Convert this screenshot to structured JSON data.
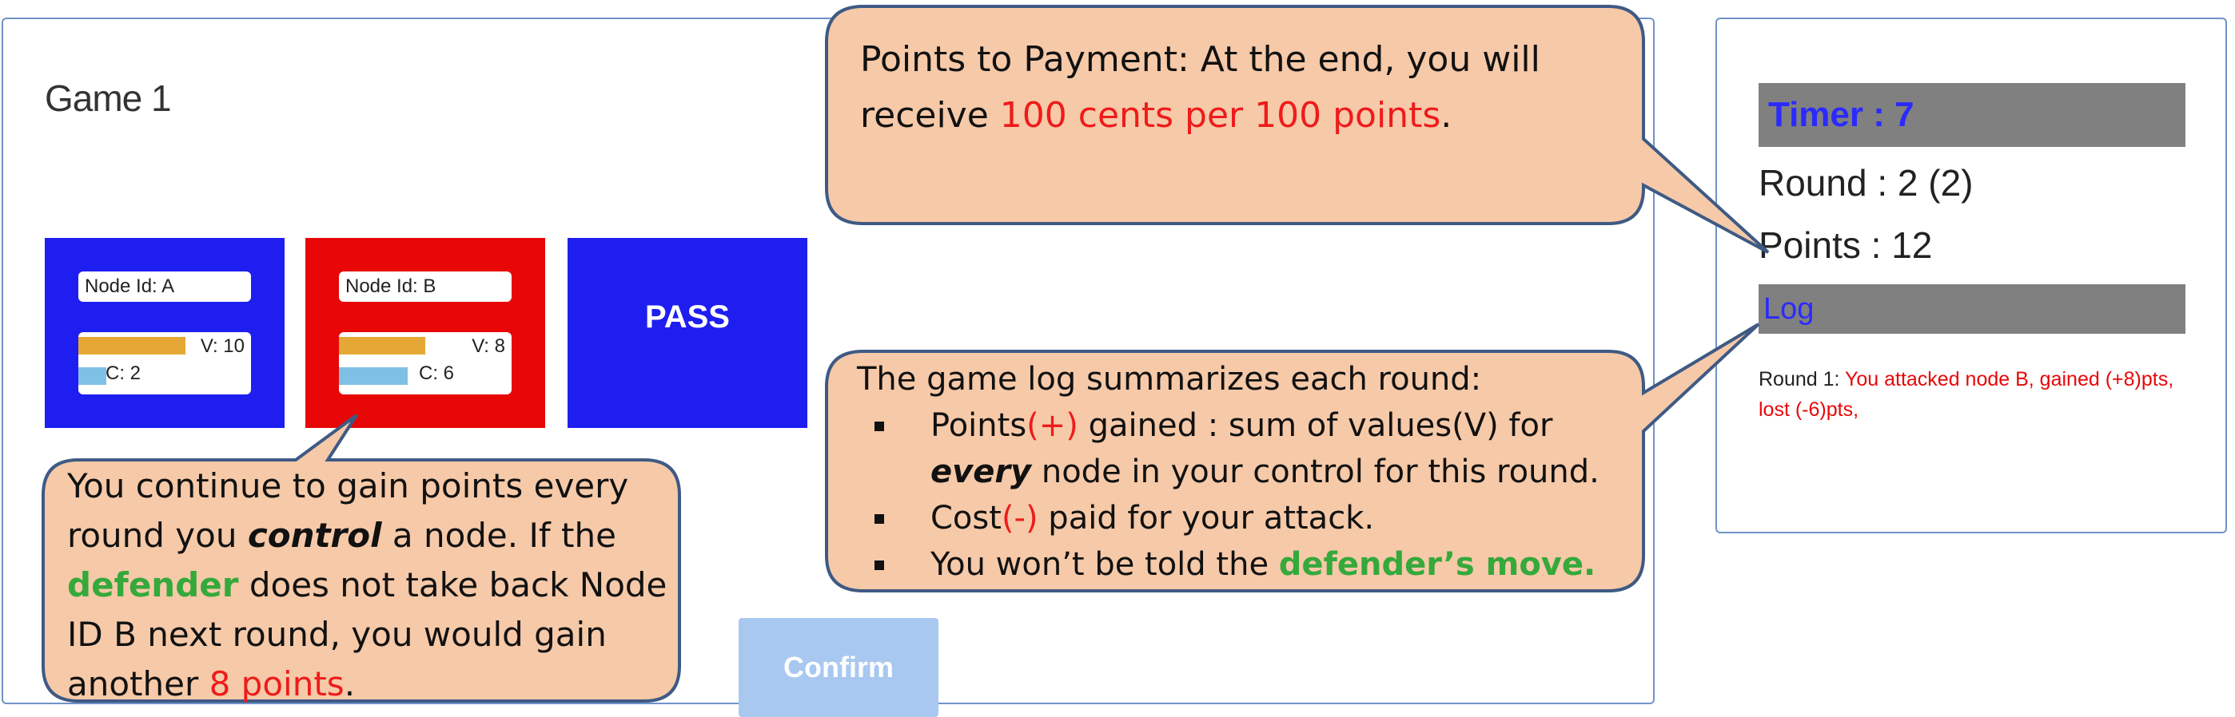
{
  "game": {
    "title": "Game 1",
    "nodes": [
      {
        "id_label": "Node Id: A",
        "value_label": "V: 10",
        "cost_label": "C: 2",
        "value_fraction": 0.62,
        "cost_fraction": 0.16,
        "color": "#1e1ef0"
      },
      {
        "id_label": "Node Id: B",
        "value_label": "V: 8",
        "cost_label": "C: 6",
        "value_fraction": 0.5,
        "cost_fraction": 0.4,
        "color": "#e80707"
      }
    ],
    "pass_label": "PASS",
    "confirm_label": "Confirm"
  },
  "sidebar": {
    "timer": "Timer : 7",
    "round": "Round : 2 (2)",
    "points": "Points : 12",
    "log_label": "Log",
    "log_entry": {
      "prefix": "Round 1: ",
      "text": "You attacked node B, gained (+8)pts, lost (-6)pts,"
    }
  },
  "callouts": {
    "payment": {
      "text1": "Points to Payment: At the end, you will receive ",
      "highlight": "100 cents per 100 points",
      "text2": "."
    },
    "log": {
      "intro": "The game log summarizes each round:",
      "item1_a": "Points",
      "item1_sign": "(+)",
      "item1_b": " gained : sum of values(V) for ",
      "item1_emph": "every",
      "item1_c": " node in your control for this round.",
      "item2_a": "Cost",
      "item2_sign": "(-)",
      "item2_b": " paid for your attack.",
      "item3_a": "You won’t be told the ",
      "item3_green": "defender’s move."
    },
    "control": {
      "t1": "You continue to gain points every round you ",
      "emph": "control",
      "t2": " a node. If the ",
      "green": "defender",
      "t3": " does not take back Node ID B next round, you would gain another ",
      "red": "8 points",
      "t4": "."
    }
  },
  "colors": {
    "callout_fill": "#f6c9a8",
    "callout_stroke": "#3e5a84",
    "timer_text": "#2a2aff",
    "panel_border": "#6f93c8"
  }
}
